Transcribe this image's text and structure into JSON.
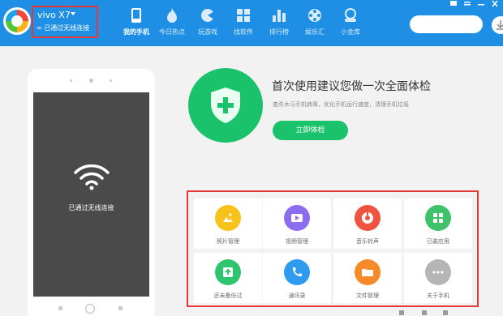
{
  "header": {
    "device": {
      "name": "vivo X7",
      "status": "已通过无线连接"
    },
    "nav": [
      {
        "label": "我的手机",
        "icon": "phone-icon",
        "active": true
      },
      {
        "label": "今日热点",
        "icon": "flame-icon",
        "active": false
      },
      {
        "label": "玩游戏",
        "icon": "gamepad-icon",
        "active": false
      },
      {
        "label": "找软件",
        "icon": "apps-icon",
        "active": false
      },
      {
        "label": "排行榜",
        "icon": "bar-chart-icon",
        "active": false
      },
      {
        "label": "娱乐汇",
        "icon": "film-reel-icon",
        "active": false
      },
      {
        "label": "小金库",
        "icon": "treasure-icon",
        "active": false
      }
    ]
  },
  "phone": {
    "screen_text": "已通过无线连接"
  },
  "health_check": {
    "title": "首次使用建议您做一次全面体检",
    "description": "查杀木马手机病毒，优化手机运行速度，清理手机垃圾",
    "button": "立即体检"
  },
  "tools": [
    {
      "label": "照片管理",
      "icon": "photo-icon",
      "color": "#f7c21b"
    },
    {
      "label": "视频管理",
      "icon": "video-icon",
      "color": "#8a6df0"
    },
    {
      "label": "音乐铃声",
      "icon": "music-icon",
      "color": "#f0533f"
    },
    {
      "label": "已装应用",
      "icon": "installed-apps-icon",
      "color": "#3fc26a"
    },
    {
      "label": "还未备份过",
      "icon": "backup-icon",
      "color": "#2fc56e"
    },
    {
      "label": "通讯录",
      "icon": "contacts-icon",
      "color": "#2e9af0"
    },
    {
      "label": "文件管理",
      "icon": "folder-icon",
      "color": "#f58a2a"
    },
    {
      "label": "关于手机",
      "icon": "more-icon",
      "color": "#b5b5b5"
    }
  ],
  "colors": {
    "header": "#1f8fe5",
    "accent_green": "#1ac36b",
    "highlight_border": "#e53935"
  }
}
